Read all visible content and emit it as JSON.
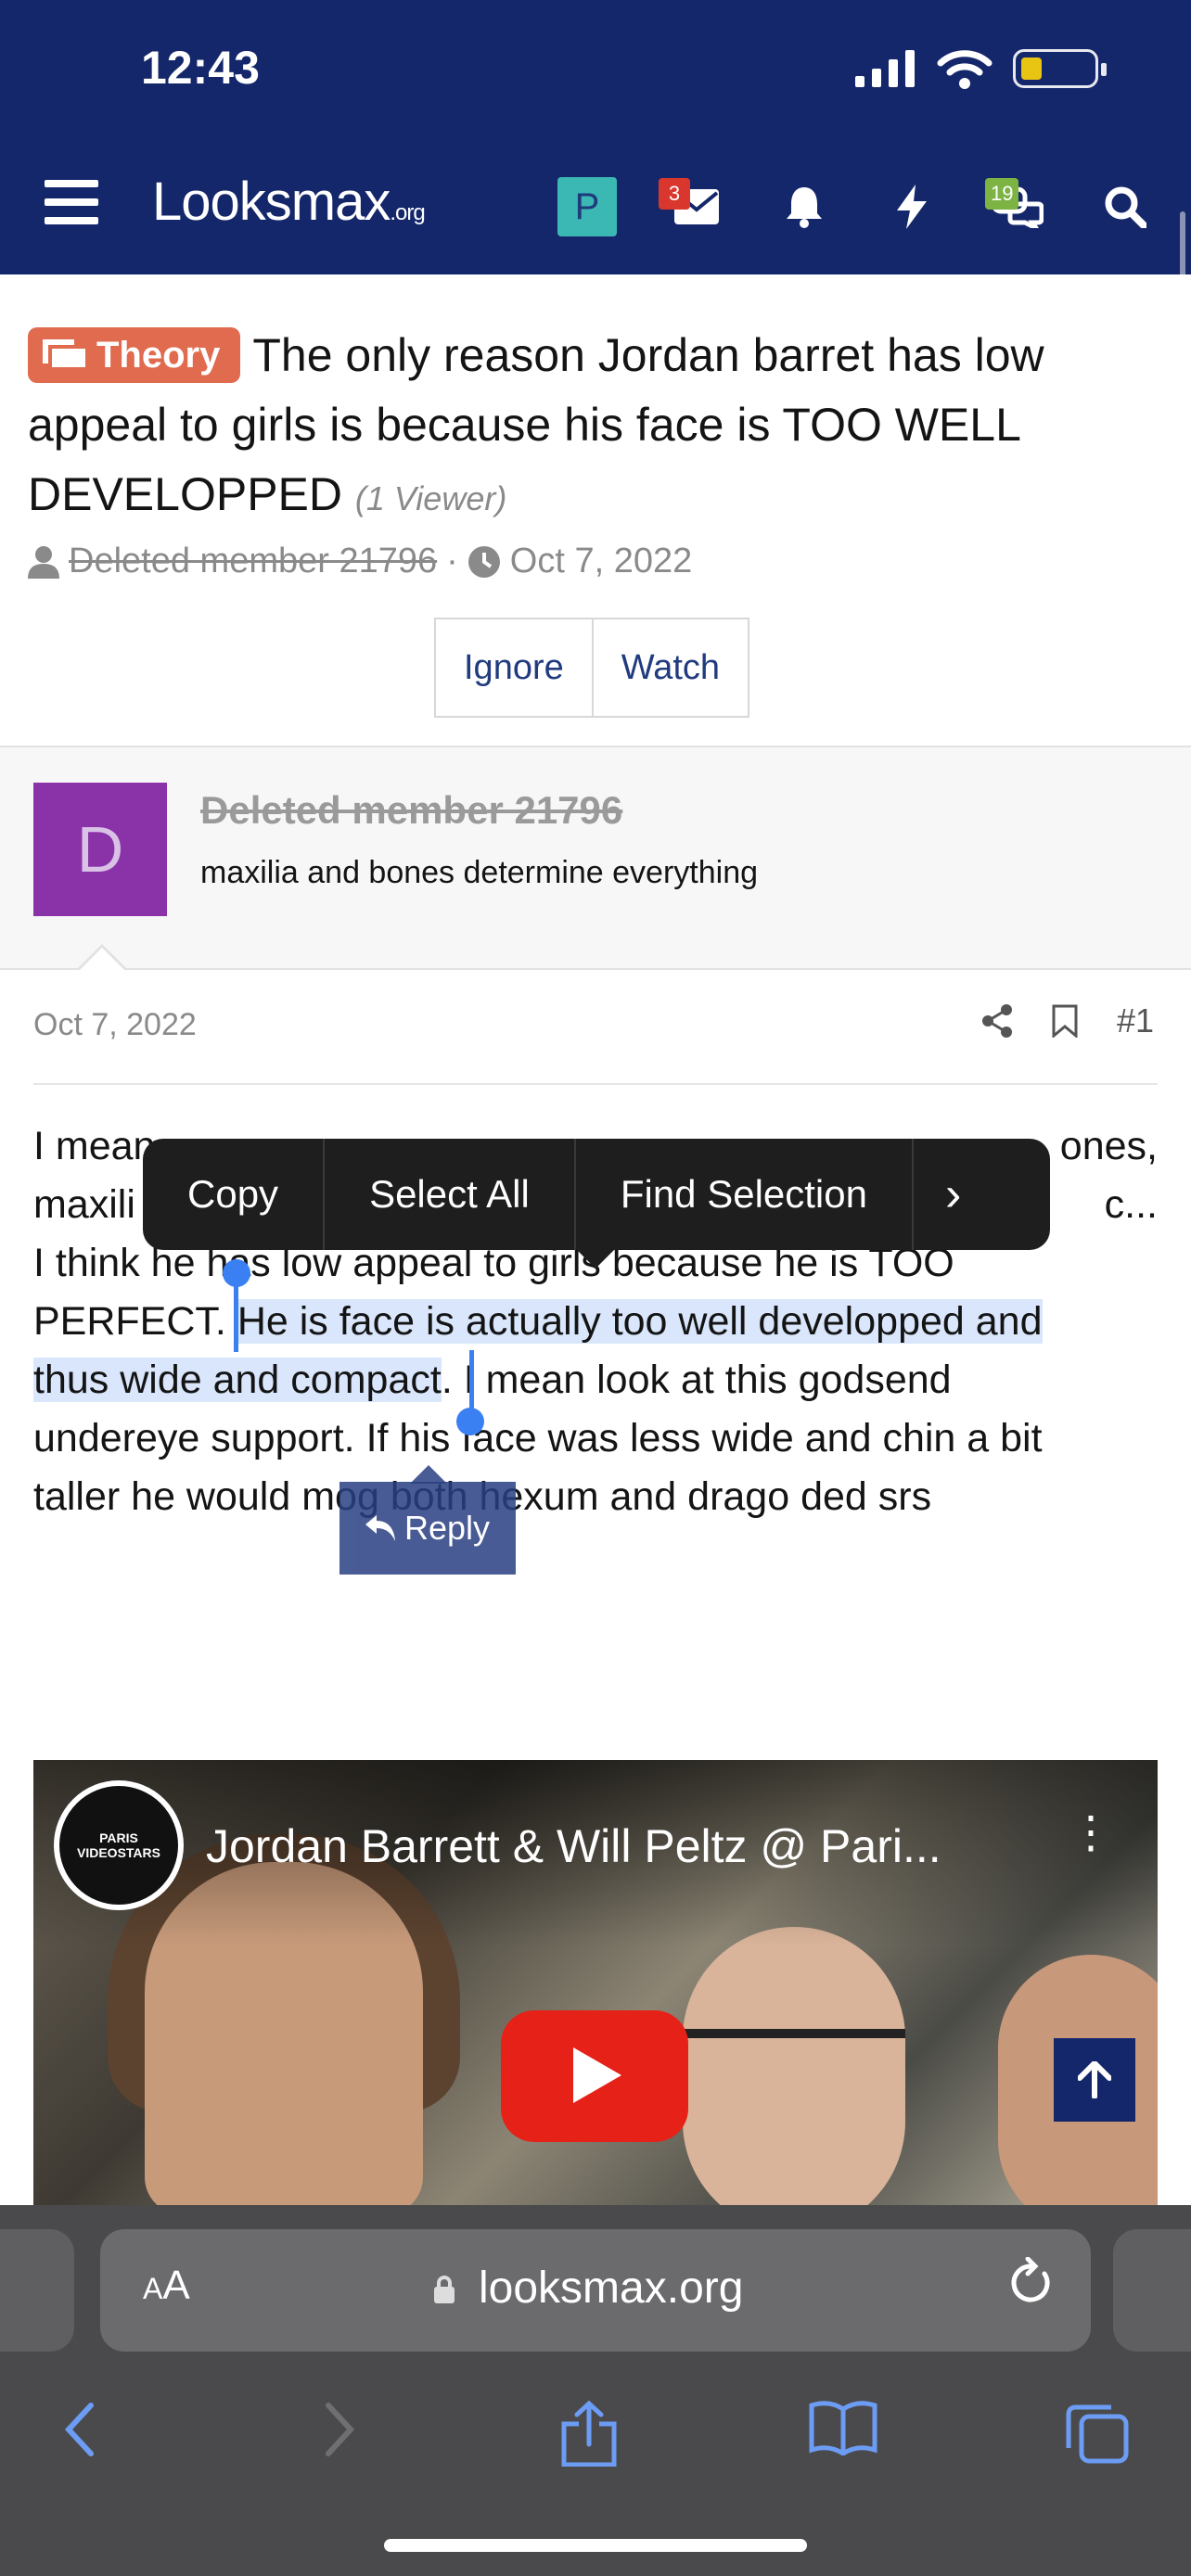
{
  "status_bar": {
    "time": "12:43"
  },
  "header": {
    "logo_main": "Looksmax",
    "logo_suffix": ".org",
    "profile_initial": "P",
    "inbox_badge": "3",
    "chat_badge": "19"
  },
  "thread": {
    "prefix": "Theory",
    "title": "The only reason Jordan barret has low appeal to girls is because his face is TOO WELL DEVELOPPED",
    "viewers": "(1 Viewer)",
    "author": "Deleted member 21796",
    "separator": "·",
    "date": "Oct 7, 2022",
    "ignore_label": "Ignore",
    "watch_label": "Watch"
  },
  "post": {
    "avatar_letter": "D",
    "username": "Deleted member 21796",
    "user_title": "maxilia and bones determine everything",
    "date": "Oct 7, 2022",
    "number": "#1",
    "text_line1": "I mean ",
    "text_line1_end": "ones,",
    "text_line2_start": "maxili",
    "text_line2_end": "c...",
    "text_line3": "I think he has low appeal to girls because he is TOO",
    "text_line4_start": "PERFECT. ",
    "text_selected_a": "He is face is actually too well developped and",
    "text_selected_b": "thus wide and compact",
    "text_line5_end": ". I mean look at this godsend",
    "text_line6": "undereye support. If his face was less wide and chin a bit",
    "text_line7": "taller he would mog both hexum and drago ded srs",
    "reply_label": "Reply"
  },
  "context_menu": {
    "copy": "Copy",
    "select_all": "Select All",
    "find_selection": "Find Selection",
    "more": "›"
  },
  "video": {
    "channel_logo_text": "PARIS VIDEOSTARS",
    "title": "Jordan Barrett & Will Peltz @ Pari..."
  },
  "safari": {
    "aa_big": "A",
    "aa_small": "A",
    "url": "looksmax.org"
  },
  "colors": {
    "header_bg": "#15276b",
    "prefix_bg": "#e06b4f",
    "avatar_bg": "#8a33a9",
    "selection": "#d9e6fb",
    "safari_bg": "#4a4a4c"
  }
}
